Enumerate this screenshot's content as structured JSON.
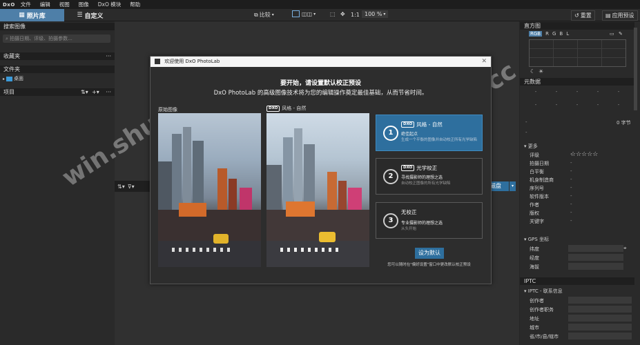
{
  "menu": {
    "logo": "DxO",
    "items": [
      "文件",
      "编辑",
      "视图",
      "图像",
      "DxO 模块",
      "帮助"
    ]
  },
  "tabs": {
    "library": "照片库",
    "customize": "自定义"
  },
  "toolbar": {
    "compare": "比较",
    "ratio": "1:1",
    "zoom": "100 %",
    "reset": "重置",
    "apply_preset": "应用预设"
  },
  "left": {
    "search_header": "搜索图像",
    "search_placeholder": "拍摄日期、评级、拍摄参数...",
    "favorites": "收藏夹",
    "folders": "文件夹",
    "desktop": "桌面",
    "projects": "项目"
  },
  "center": {
    "disk_partial": "磁盘"
  },
  "dialog": {
    "title": "欢迎使用 DxO PhotoLab",
    "heading": "要开始，请设置默认校正预设",
    "subheading": "DxO PhotoLab 的高级图像技术将为您的编辑操作奠定最佳基础，从而节省时间。",
    "original_label": "原始图像",
    "preview_label": "风格 - 自然",
    "set_default": "设为默认",
    "footnote": "您可以随时在\"偏好设置\"窗口中更改默认校正预设",
    "options": [
      {
        "num": "1",
        "title": "风格 - 自然",
        "sub1": "绝佳起点",
        "sub2": "生成一个平衡的图像并自动校正所有光学缺陷",
        "selected": true
      },
      {
        "num": "2",
        "title": "光学校正",
        "sub1": "寻找摄影师的理想之选",
        "sub2": "自动校正图像的所有光学缺陷",
        "selected": false
      },
      {
        "num": "3",
        "title": "无校正",
        "sub1": "专业摄影师的理想之选",
        "sub2": "从头开始",
        "selected": false
      }
    ]
  },
  "right": {
    "histogram": "直方图",
    "hist_tabs": [
      "RGB",
      "R",
      "G",
      "B",
      "L"
    ],
    "metadata": "元数据",
    "bytes": "0 字节",
    "more": "更多",
    "meta_fields": [
      "评级",
      "拍摄日期",
      "白平衡",
      "机身制造商",
      "序列号",
      "软件版本",
      "作者",
      "版权",
      "关键字"
    ],
    "gps": "GPS 坐标",
    "gps_fields": [
      "纬度",
      "经度",
      "海拔"
    ],
    "iptc": "IPTC",
    "iptc_contact": "IPTC - 联系信息",
    "iptc_fields": [
      "创作者",
      "创作者职务",
      "地址",
      "城市",
      "省/市/县/辖市"
    ]
  },
  "watermark": "win.shuiche.cc",
  "colors": {
    "accent": "#4e7fa8",
    "selected_card": "#2e6f9e"
  }
}
